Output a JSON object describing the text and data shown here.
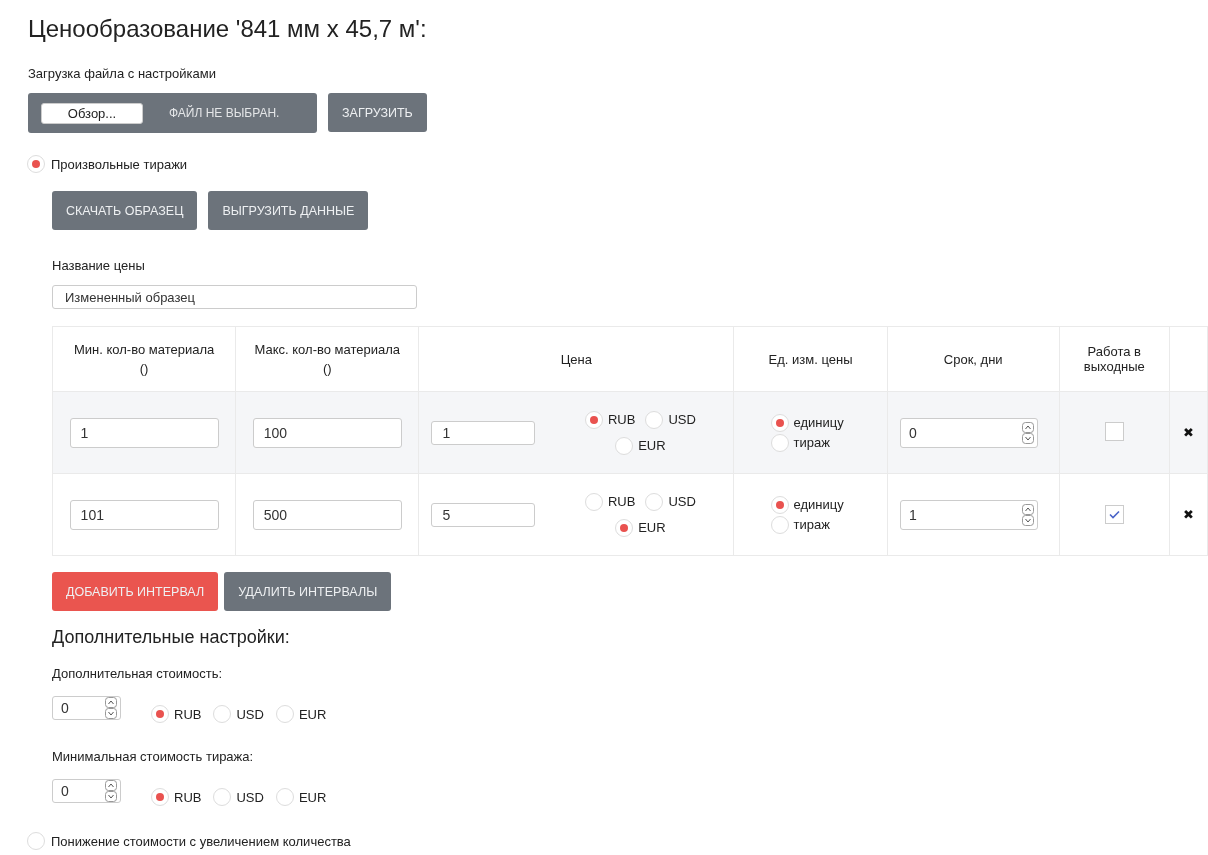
{
  "title": "Ценообразование '841 мм x 45,7 м':",
  "file_upload": {
    "label": "Загрузка файла с настройками",
    "browse_button": "Обзор...",
    "file_status": "ФАЙЛ НЕ ВЫБРАН.",
    "upload_button": "ЗАГРУЗИТЬ"
  },
  "custom_runs": {
    "label": "Произвольные тиражи",
    "selected": true
  },
  "actions": [
    "СКАЧАТЬ ОБРАЗЕЦ",
    "ВЫГРУЗИТЬ ДАННЫЕ"
  ],
  "price_name": {
    "label": "Название цены",
    "value": "Измененный образец"
  },
  "table": {
    "columns": [
      {
        "label": "Мин. кол-во материала",
        "unit": "()"
      },
      {
        "label": "Макс. кол-во материала",
        "unit": "()"
      },
      {
        "label": "Цена"
      },
      {
        "label": "Ед. изм. цены"
      },
      {
        "label": "Срок, дни"
      },
      {
        "label": "Работа в выходные"
      }
    ],
    "rows": [
      {
        "min": "1",
        "max": "100",
        "price": "1",
        "currencies": [
          {
            "label": "RUB",
            "selected": true
          },
          {
            "label": "USD",
            "selected": false
          },
          {
            "label": "EUR",
            "selected": false
          }
        ],
        "units": [
          {
            "label": "единицу",
            "selected": true
          },
          {
            "label": "тираж",
            "selected": false
          }
        ],
        "days": "0",
        "weekends": false,
        "delete": "✖"
      },
      {
        "min": "101",
        "max": "500",
        "price": "5",
        "currencies": [
          {
            "label": "RUB",
            "selected": false
          },
          {
            "label": "USD",
            "selected": false
          },
          {
            "label": "EUR",
            "selected": true
          }
        ],
        "units": [
          {
            "label": "единицу",
            "selected": true
          },
          {
            "label": "тираж",
            "selected": false
          }
        ],
        "days": "1",
        "weekends": true,
        "delete": "✖"
      }
    ]
  },
  "buttons": [
    {
      "label": "ДОБАВИТЬ ИНТЕРВАЛ",
      "kind": "primary"
    },
    {
      "label": "УДАЛИТЬ ИНТЕРВАЛЫ",
      "kind": "secondary"
    }
  ],
  "extra": {
    "title": "Дополнительные настройки:",
    "sections": [
      {
        "label": "Дополнительная стоимость:",
        "value": "0",
        "currencies": [
          {
            "label": "RUB",
            "selected": true
          },
          {
            "label": "USD",
            "selected": false
          },
          {
            "label": "EUR",
            "selected": false
          }
        ]
      },
      {
        "label": "Минимальная стоимость тиража:",
        "value": "0",
        "currencies": [
          {
            "label": "RUB",
            "selected": true
          },
          {
            "label": "USD",
            "selected": false
          },
          {
            "label": "EUR",
            "selected": false
          }
        ]
      }
    ]
  },
  "discount": {
    "label": "Понижение стоимости с увеличением количества",
    "selected": false
  }
}
